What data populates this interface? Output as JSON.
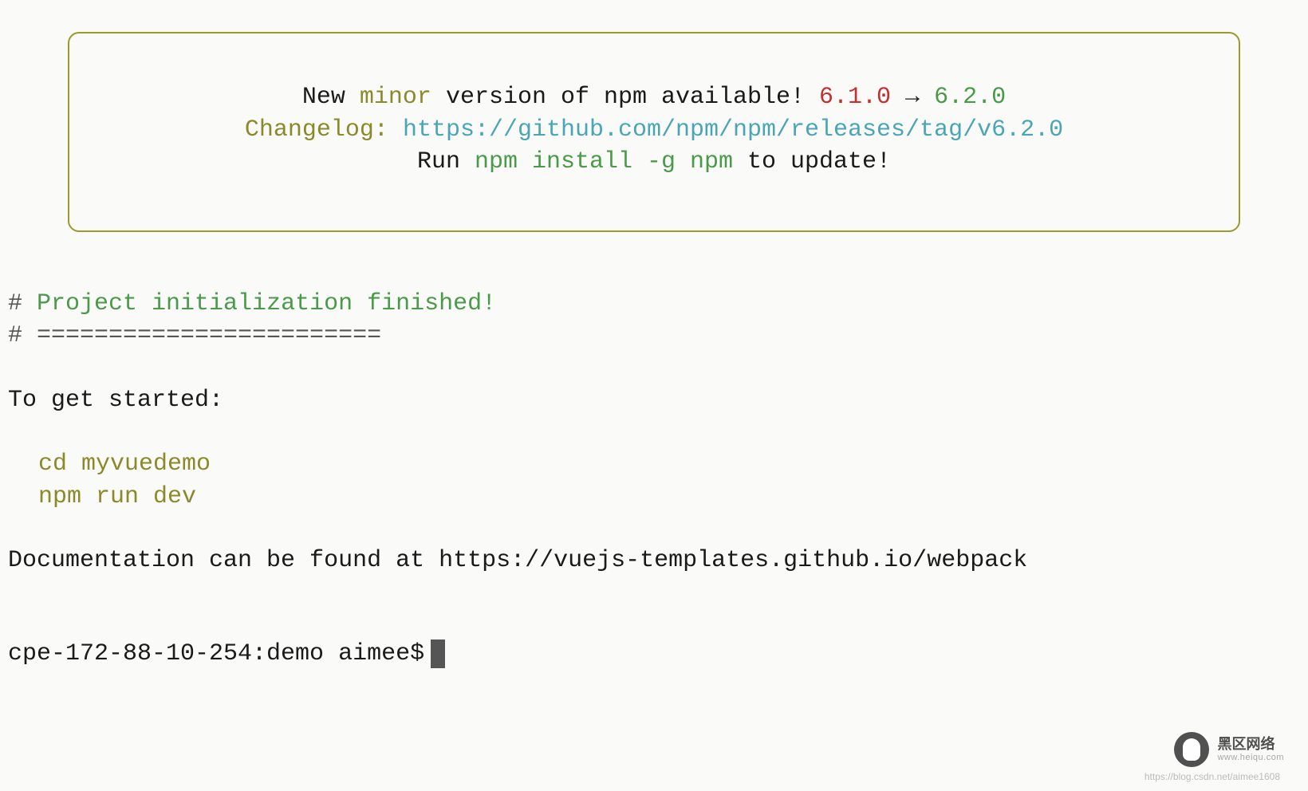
{
  "notice": {
    "line1_prefix": "New ",
    "line1_minor": "minor",
    "line1_mid": " version of npm available! ",
    "line1_old": "6.1.0",
    "line1_arrow": " → ",
    "line1_new": "6.2.0",
    "line2_label": "Changelog: ",
    "line2_url": "https://github.com/npm/npm/releases/tag/v6.2.0",
    "line3_prefix": "Run ",
    "line3_cmd": "npm install -g npm",
    "line3_suffix": " to update!"
  },
  "init": {
    "hash1": "# ",
    "finished": "Project initialization finished!",
    "hash2": "# ========================"
  },
  "started": {
    "label": "To get started:",
    "cmd1": "cd myvuedemo",
    "cmd2": "npm run dev"
  },
  "docs": {
    "text": "Documentation can be found at https://vuejs-templates.github.io/webpack"
  },
  "prompt": {
    "text": "cpe-172-88-10-254:demo aimee$ "
  },
  "watermark": {
    "name": "黑区网络",
    "domain": "www.heiqu.com",
    "url": "https://blog.csdn.net/aimee1608"
  }
}
